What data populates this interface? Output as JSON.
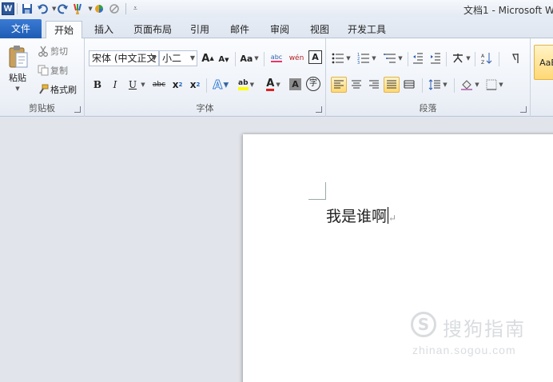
{
  "window": {
    "title": "文档1 - Microsoft W"
  },
  "quick_access": {
    "icons": [
      "word-logo",
      "save-icon",
      "undo-icon",
      "redo-icon",
      "format-painter-icon",
      "color-circle-icon",
      "clear-icon",
      "customize-icon"
    ],
    "word_logo_letter": "W"
  },
  "tabs": [
    {
      "label": "文件"
    },
    {
      "label": "开始"
    },
    {
      "label": "插入"
    },
    {
      "label": "页面布局"
    },
    {
      "label": "引用"
    },
    {
      "label": "邮件"
    },
    {
      "label": "审阅"
    },
    {
      "label": "视图"
    },
    {
      "label": "开发工具"
    }
  ],
  "ribbon": {
    "clipboard": {
      "label": "剪贴板",
      "paste": "粘贴",
      "cut": "剪切",
      "copy": "复制",
      "format_painter": "格式刷"
    },
    "font": {
      "label": "字体",
      "font_name": "宋体 (中文正文",
      "font_size": "小二",
      "grow_font": "A",
      "shrink_font": "A",
      "change_case": "Aa",
      "clear_format": "abc",
      "phonetic": "wén",
      "char_border": "A",
      "bold": "B",
      "italic": "I",
      "underline": "U",
      "strikethrough": "abc",
      "subscript": "x",
      "superscript": "x",
      "text_effect": "A",
      "highlight": "ab",
      "font_color": "A",
      "char_shading": "A",
      "enclose": "字"
    },
    "paragraph": {
      "label": "段落"
    },
    "styles": {
      "preview": "AaB"
    }
  },
  "document": {
    "text": "我是谁啊"
  },
  "watermark": {
    "logo_letter": "S",
    "brand": "搜狗指南",
    "url": "zhinan.sogou.com"
  },
  "colors": {
    "file_tab": "#2b6cc4",
    "highlight_yellow": "#ffff00",
    "font_red": "#e02020",
    "text_effect_blue": "#3b7fd4",
    "active_align": "#ffd874"
  }
}
